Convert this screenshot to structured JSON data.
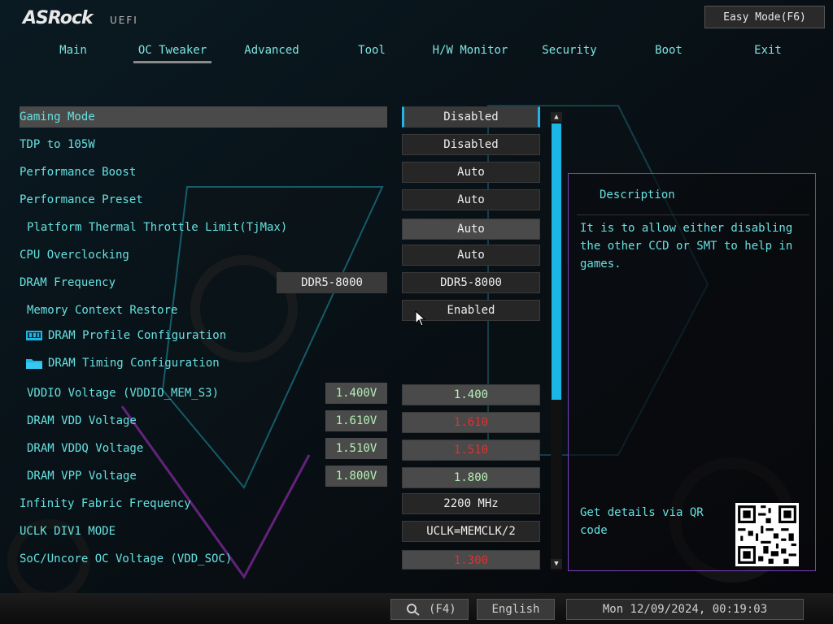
{
  "header": {
    "brand": "ASRock",
    "brand_sub": "UEFI",
    "easy_mode_label": "Easy Mode(F6)"
  },
  "tabs": [
    {
      "label": "Main"
    },
    {
      "label": "OC Tweaker",
      "active": true
    },
    {
      "label": "Advanced"
    },
    {
      "label": "Tool"
    },
    {
      "label": "H/W Monitor"
    },
    {
      "label": "Security"
    },
    {
      "label": "Boot"
    },
    {
      "label": "Exit"
    }
  ],
  "settings": {
    "gaming_mode": {
      "label": "Gaming Mode",
      "value": "Disabled"
    },
    "tdp_105w": {
      "label": "TDP to 105W",
      "value": "Disabled"
    },
    "performance_boost": {
      "label": "Performance Boost",
      "value": "Auto"
    },
    "performance_preset": {
      "label": "Performance Preset",
      "value": "Auto"
    },
    "thermal_limit": {
      "label": "Platform Thermal Throttle Limit(TjMax)",
      "value": "Auto"
    },
    "cpu_oc": {
      "label": "CPU Overclocking",
      "value": "Auto"
    },
    "dram_freq": {
      "label": "DRAM Frequency",
      "current": "DDR5-8000",
      "value": "DDR5-8000"
    },
    "mem_context": {
      "label": "Memory Context Restore",
      "value": "Enabled"
    },
    "dram_profile": {
      "label": "DRAM Profile Configuration"
    },
    "dram_timing": {
      "label": "DRAM Timing Configuration"
    },
    "vddio": {
      "label": "VDDIO Voltage (VDDIO_MEM_S3)",
      "current": "1.400V",
      "value": "1.400"
    },
    "dram_vdd": {
      "label": "DRAM VDD Voltage",
      "current": "1.610V",
      "value": "1.610"
    },
    "dram_vddq": {
      "label": "DRAM VDDQ Voltage",
      "current": "1.510V",
      "value": "1.510"
    },
    "dram_vpp": {
      "label": "DRAM VPP Voltage",
      "current": "1.800V",
      "value": "1.800"
    },
    "infinity_fabric": {
      "label": "Infinity Fabric Frequency",
      "value": "2200 MHz"
    },
    "uclk": {
      "label": "UCLK DIV1 MODE",
      "value": "UCLK=MEMCLK/2"
    },
    "soc_voltage": {
      "label": "SoC/Uncore OC Voltage (VDD_SOC)",
      "value": "1.300"
    }
  },
  "description": {
    "title": "Description",
    "text": "It is to allow either disabling\nthe other CCD or SMT to help in\ngames.",
    "qr_text": "Get details via QR\ncode"
  },
  "footer": {
    "search_key": "(F4)",
    "language": "English",
    "datetime": "Mon 12/09/2024, 00:19:03"
  },
  "colors": {
    "label": "#66e0e0",
    "accent": "#1ab7e6",
    "warning": "#e03030",
    "border_purple": "#7a3fc0"
  }
}
